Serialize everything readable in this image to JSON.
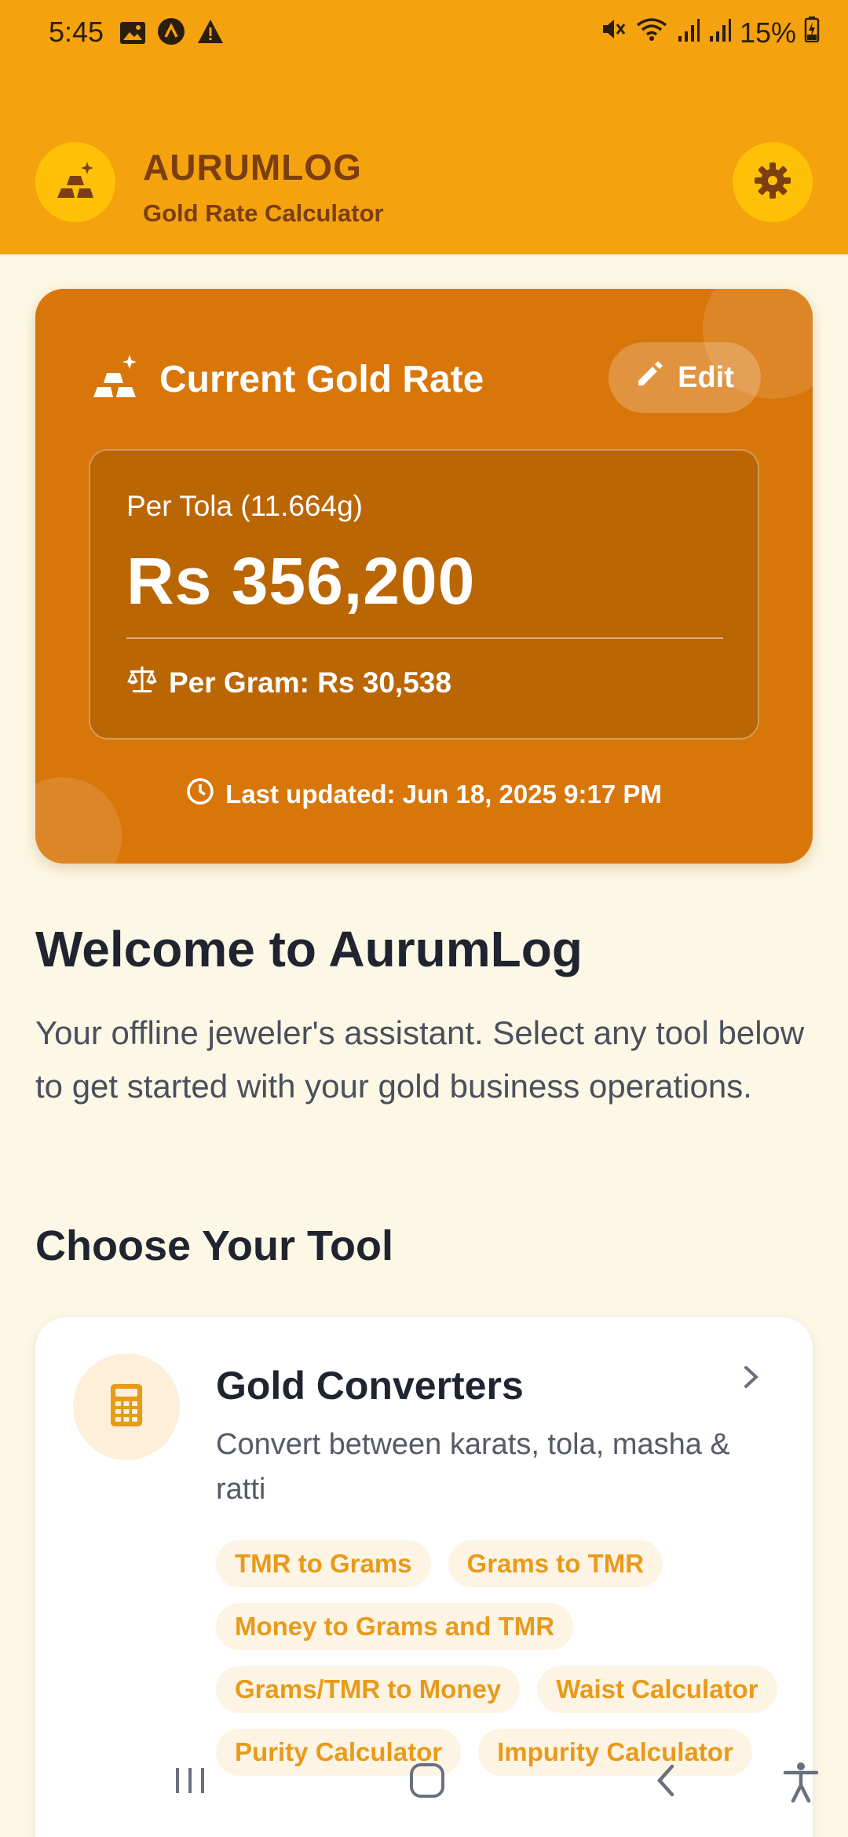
{
  "status": {
    "time": "5:45",
    "battery": "15%",
    "icons": [
      "image-icon",
      "app-icon",
      "warning-icon",
      "mute-icon",
      "wifi-icon",
      "signal-icon",
      "signal-icon",
      "battery-charging-icon"
    ]
  },
  "header": {
    "title": "AURUMLOG",
    "subtitle": "Gold Rate Calculator",
    "logo_icon": "gold-bars-icon",
    "settings_icon": "gear-icon"
  },
  "rate_card": {
    "title": "Current Gold Rate",
    "edit_label": "Edit",
    "per_tola_label": "Per Tola (11.664g)",
    "price": "Rs 356,200",
    "per_gram": "Per Gram: Rs 30,538",
    "last_updated": "Last updated: Jun 18, 2025 9:17 PM"
  },
  "welcome": {
    "title": "Welcome to AurumLog",
    "text": "Your offline jeweler's assistant. Select any tool below to get started with your gold business operations."
  },
  "tools_section": {
    "title": "Choose Your Tool",
    "tools": [
      {
        "title": "Gold Converters",
        "description": "Convert between karats, tola, masha & ratti",
        "icon": "calculator-icon",
        "chips": [
          "TMR to Grams",
          "Grams to TMR",
          "Money to Grams and TMR",
          "Grams/TMR to Money",
          "Waist Calculator",
          "Purity Calculator",
          "Impurity Calculator"
        ]
      }
    ]
  },
  "colors": {
    "header": "#F5A20F",
    "card": "#D9760A",
    "card_inner": "#BA6604",
    "background": "#FDF8E6",
    "chip_text": "#E89A1A"
  }
}
